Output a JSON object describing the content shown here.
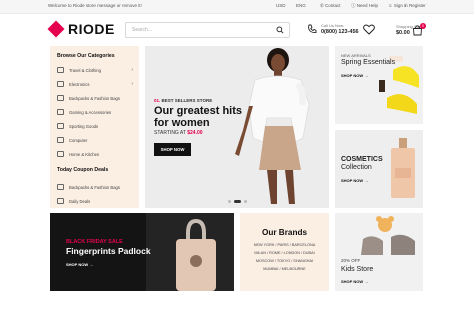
{
  "topbar": {
    "welcome": "Welcome to Riode store message or remove it!",
    "currency": "USD",
    "language": "ENG",
    "contact": "Contact",
    "need_help": "Need Help",
    "sign_in": "Sign in",
    "register": "Register",
    "slash": "/"
  },
  "header": {
    "logo_text": "RIODE",
    "search_placeholder": "Search...",
    "call_label": "Call Us Now:",
    "call_number": "0(800) 123-456",
    "cart_label": "Shopping Cart:",
    "cart_total": "$0.00",
    "cart_count": "0"
  },
  "sidebar": {
    "heading": "Browse Our Categories",
    "categories": [
      {
        "label": "Travel & Clothing",
        "arrow": "›"
      },
      {
        "label": "Electronics",
        "arrow": "›"
      },
      {
        "label": "Backpacks & Fashion Bags",
        "arrow": ""
      },
      {
        "label": "Gaming & Accessories",
        "arrow": ""
      },
      {
        "label": "Sporting Goods",
        "arrow": ""
      },
      {
        "label": "Computer",
        "arrow": ""
      },
      {
        "label": "Home & Kitchen",
        "arrow": ""
      }
    ],
    "coupon_heading": "Today Coupon Deals",
    "coupons": [
      {
        "label": "Backpacks & Fashion Bags"
      },
      {
        "label": "Daily Deals"
      }
    ]
  },
  "hero": {
    "subtitle_num": "01.",
    "subtitle": "BEST SELLERS STORE",
    "headline_1": "Our greatest hits",
    "headline_2": "for women",
    "price_prefix": "STARTING AT",
    "price": "$24.00",
    "button": "SHOP NOW"
  },
  "promos": {
    "spring": {
      "small": "NEW ARRIVALS",
      "title": "Spring Essentials",
      "shop": "SHOP NOW"
    },
    "cosmetics": {
      "title_1": "COSMETICS",
      "title_2": "Collection",
      "shop": "SHOP NOW"
    },
    "black_friday": {
      "sale": "BLACK FRIDAY SALE",
      "product": "Fingerprints Padlock",
      "shop": "SHOP NOW"
    },
    "brands": {
      "title": "Our Brands",
      "lines": [
        "NEW YORK / PARIS / BARCELONA",
        "MILAN / ROME / LONDON / DUBAI",
        "MOSCOW / TOKYO / SHANGHAI",
        "MUMBAI / MELBOURNE"
      ]
    },
    "kids": {
      "pct": "20% OFF",
      "title": "Kids Store",
      "shop": "SHOP NOW"
    }
  },
  "colors": {
    "accent": "#e4004f",
    "peach": "#fbeee3",
    "dark": "#141414"
  }
}
